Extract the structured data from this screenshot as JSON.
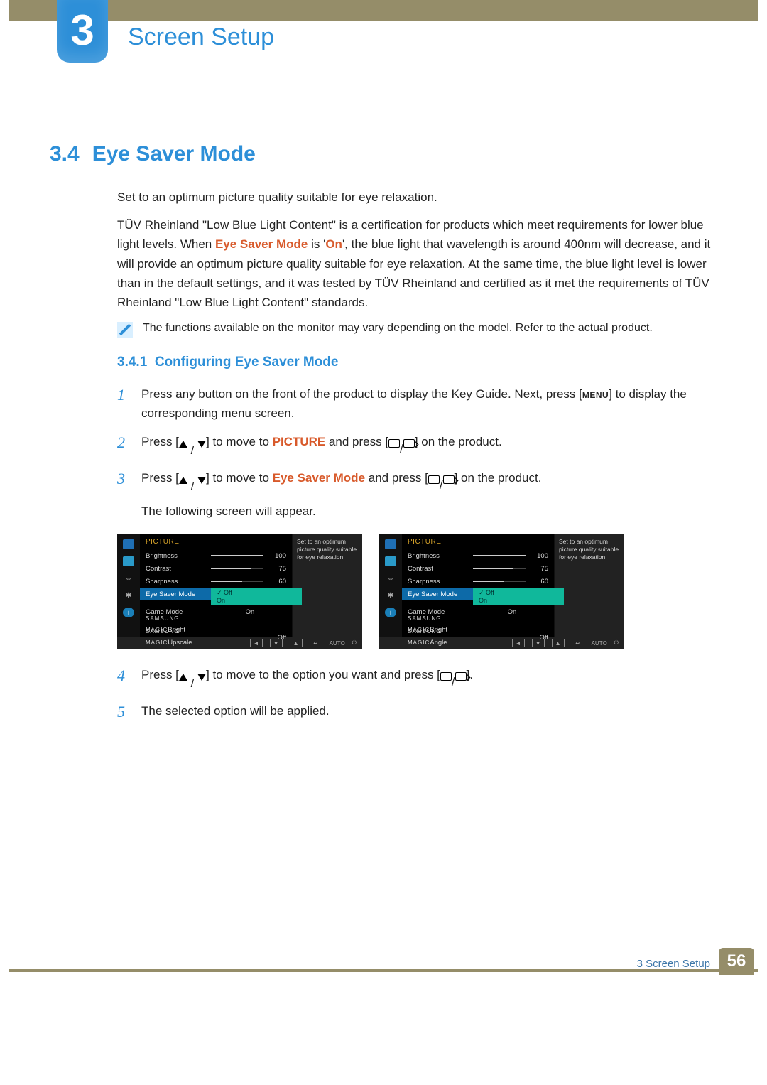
{
  "chapter": {
    "num": "3",
    "title": "Screen Setup"
  },
  "section": {
    "num": "3.4",
    "title": "Eye Saver Mode"
  },
  "intro1": "Set to an optimum picture quality suitable for eye relaxation.",
  "intro2a": "TÜV Rheinland \"Low Blue Light Content\" is a certification for products which meet requirements for lower blue light levels. When ",
  "intro2_h1": "Eye Saver Mode",
  "intro2b": " is '",
  "intro2_h2": "On",
  "intro2c": "', the blue light that wavelength is around 400nm will decrease, and it will provide an optimum picture quality suitable for eye relaxation. At the same time, the blue light level is lower than in the default settings, and it was tested by TÜV Rheinland and certified as it met the requirements of TÜV Rheinland \"Low Blue Light Content\" standards.",
  "note": "The functions available on the monitor may vary depending on the model. Refer to the actual product.",
  "subsection": {
    "num": "3.4.1",
    "title": "Configuring Eye Saver Mode"
  },
  "steps": {
    "s1a": "Press any button on the front of the product to display the Key Guide. Next, press [",
    "s1_menu": "MENU",
    "s1b": "] to display the corresponding menu screen.",
    "s2a": "Press [",
    "s2b": "] to move to ",
    "s2_h": "PICTURE",
    "s2c": " and press [",
    "s2d": "] on the product.",
    "s3a": "Press [",
    "s3b": "] to move to ",
    "s3_h": "Eye Saver Mode",
    "s3c": " and press [",
    "s3d": "] on the product.",
    "s3e": "The following screen will appear.",
    "s4a": "Press [",
    "s4b": "] to move to the option you want and press [",
    "s4c": "].",
    "s5": "The selected option will be applied."
  },
  "chart_data": [
    {
      "type": "table",
      "title": "PICTURE",
      "tooltip": "Set to an optimum picture quality suitable for eye relaxation.",
      "rows": [
        {
          "label": "Brightness",
          "value": 100,
          "max": 100
        },
        {
          "label": "Contrast",
          "value": 75,
          "max": 100
        },
        {
          "label": "Sharpness",
          "value": 60,
          "max": 100
        },
        {
          "label": "Eye Saver Mode",
          "value": "Off",
          "selected": true,
          "dropdown": [
            "Off",
            "On"
          ]
        },
        {
          "label": "Game Mode",
          "value": "On"
        },
        {
          "label": "SAMSUNG MAGIC Bright",
          "value": ""
        },
        {
          "label": "SAMSUNG MAGIC Upscale",
          "value": "Off"
        }
      ],
      "footer": [
        "◄",
        "▼",
        "▲",
        "↵",
        "AUTO",
        "⏻"
      ]
    },
    {
      "type": "table",
      "title": "PICTURE",
      "tooltip": "Set to an optimum picture quality suitable for eye relaxation.",
      "rows": [
        {
          "label": "Brightness",
          "value": 100,
          "max": 100
        },
        {
          "label": "Contrast",
          "value": 75,
          "max": 100
        },
        {
          "label": "Sharpness",
          "value": 60,
          "max": 100
        },
        {
          "label": "Eye Saver Mode",
          "value": "Off",
          "selected": true,
          "dropdown": [
            "Off",
            "On"
          ]
        },
        {
          "label": "Game Mode",
          "value": "On"
        },
        {
          "label": "SAMSUNG MAGIC Bright",
          "value": ""
        },
        {
          "label": "SAMSUNG MAGIC Angle",
          "value": "Off"
        }
      ],
      "footer": [
        "◄",
        "▼",
        "▲",
        "↵",
        "AUTO",
        "⏻"
      ]
    }
  ],
  "osd": {
    "title": "PICTURE",
    "tip": "Set to an optimum picture quality suitable for eye relaxation.",
    "brightness": {
      "label": "Brightness",
      "val": "100"
    },
    "contrast": {
      "label": "Contrast",
      "val": "75"
    },
    "sharpness": {
      "label": "Sharpness",
      "val": "60"
    },
    "eyesaver": {
      "label": "Eye Saver Mode"
    },
    "dropdown": {
      "off": "Off",
      "on": "On"
    },
    "game": {
      "label": "Game Mode",
      "val": "On"
    },
    "magic": "MAGIC",
    "samsung": "SAMSUNG",
    "bright": "Bright",
    "upscale": "Upscale",
    "angle": "Angle",
    "offval": "Off",
    "auto": "AUTO"
  },
  "footer": {
    "text": "3 Screen Setup",
    "page": "56"
  }
}
